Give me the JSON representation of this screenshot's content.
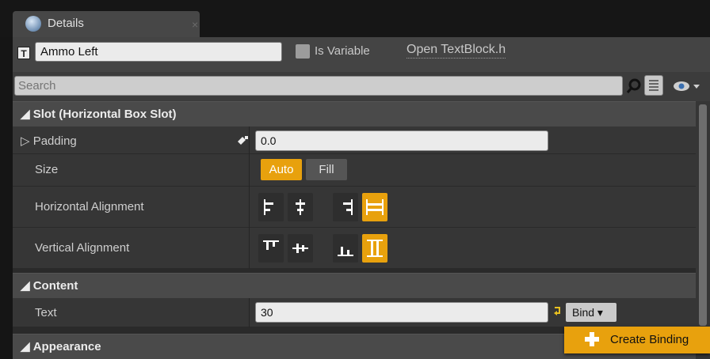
{
  "tab": {
    "title": "Details",
    "close": "×"
  },
  "header": {
    "widget_name": "Ammo Left",
    "is_variable_label": "Is Variable",
    "open_link": "Open TextBlock.h"
  },
  "search": {
    "placeholder": "Search"
  },
  "sections": {
    "slot": {
      "title": "Slot (Horizontal Box Slot)"
    },
    "content": {
      "title": "Content"
    },
    "appearance": {
      "title": "Appearance"
    }
  },
  "properties": {
    "padding": {
      "label": "Padding",
      "value": "0.0"
    },
    "size": {
      "label": "Size",
      "options": [
        "Auto",
        "Fill"
      ],
      "selected": "Auto"
    },
    "horizontal_alignment": {
      "label": "Horizontal Alignment",
      "selected_index": 3
    },
    "vertical_alignment": {
      "label": "Vertical Alignment",
      "selected_index": 3
    },
    "text": {
      "label": "Text",
      "value": "30",
      "bind_label": "Bind"
    }
  },
  "menu": {
    "create_binding": "Create Binding"
  },
  "colors": {
    "accent": "#e8a10d",
    "panel": "#3c3c3c",
    "row": "#363636",
    "section": "#4a4a4a"
  }
}
